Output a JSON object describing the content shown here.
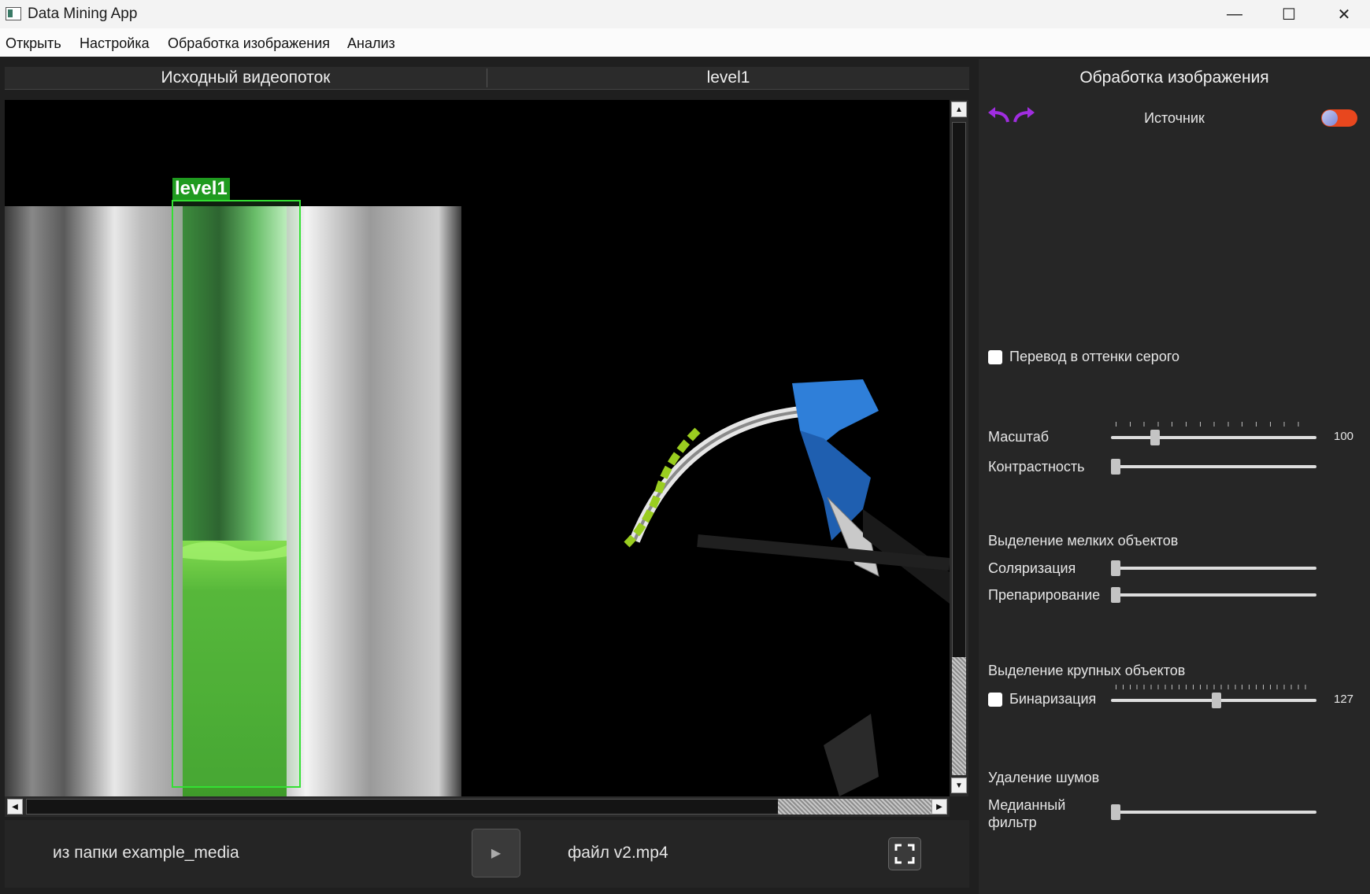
{
  "window": {
    "title": "Data Mining App"
  },
  "menu": [
    "Открыть",
    "Настройка",
    "Обработка изображения",
    "Анализ"
  ],
  "tabs": [
    "Исходный видеопоток",
    "level1"
  ],
  "viewport": {
    "roi_label": "level1"
  },
  "bottom": {
    "folder": "из папки example_media",
    "file": "файл v2.mp4"
  },
  "panel": {
    "title": "Обработка изображения",
    "source": "Источник",
    "grayscale_label": "Перевод в оттенки серого",
    "scale_label": "Масштаб",
    "scale_value": "100",
    "contrast_label": "Контрастность",
    "small_objects_title": "Выделение мелких объектов",
    "solarize_label": "Соляризация",
    "prep_label": "Препарирование",
    "large_objects_title": "Выделение крупных объектов",
    "binarize_label": "Бинаризация",
    "binarize_value": "127",
    "noise_title": "Удаление шумов",
    "median_label_1": "Медианный",
    "median_label_2": "фильтр"
  },
  "colors": {
    "toggle": "#e8471e",
    "roi": "#33e033",
    "accent_arrows": "#a02de0"
  }
}
